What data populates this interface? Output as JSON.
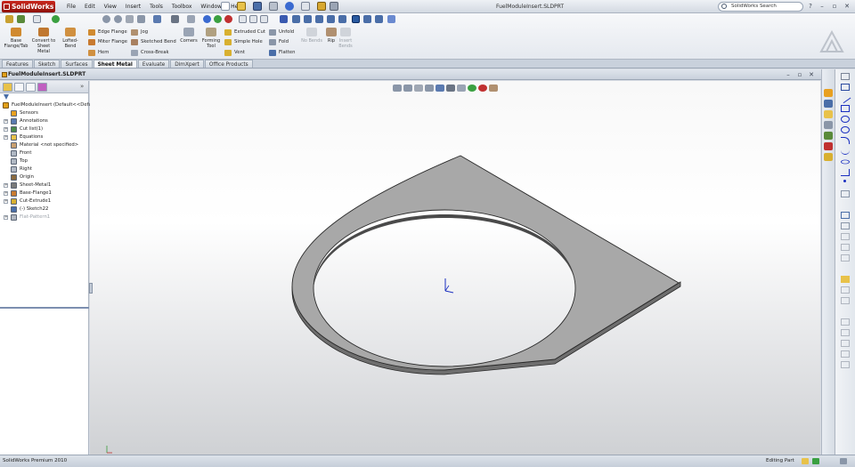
{
  "app": {
    "name": "SolidWorks",
    "file_title": "FuelModuleInsert.SLDPRT",
    "search_placeholder": "SolidWorks Search",
    "help_label": "?",
    "window_controls": [
      "minimize-icon",
      "restore-icon",
      "close-icon"
    ]
  },
  "menu": [
    "File",
    "Edit",
    "View",
    "Insert",
    "Tools",
    "Toolbox",
    "Window",
    "Help"
  ],
  "commands": {
    "large": [
      {
        "label": "Base Flange/Tab",
        "icon": "base-flange-icon"
      },
      {
        "label": "Convert to Sheet Metal",
        "icon": "convert-sheet-metal-icon"
      },
      {
        "label": "Lofted-Bend",
        "icon": "lofted-bend-icon"
      },
      {
        "label": "Corners",
        "icon": "corners-icon"
      },
      {
        "label": "Forming Tool",
        "icon": "forming-tool-icon"
      },
      {
        "label": "No Bends",
        "icon": "no-bends-icon"
      },
      {
        "label": "Rip",
        "icon": "rip-icon"
      },
      {
        "label": "Insert Bends",
        "icon": "insert-bends-icon"
      }
    ],
    "small": [
      {
        "label": "Edge Flange",
        "icon": "edge-flange-icon"
      },
      {
        "label": "Miter Flange",
        "icon": "miter-flange-icon"
      },
      {
        "label": "Hem",
        "icon": "hem-icon"
      },
      {
        "label": "Jog",
        "icon": "jog-icon"
      },
      {
        "label": "Sketched Bend",
        "icon": "sketched-bend-icon"
      },
      {
        "label": "Cross-Break",
        "icon": "cross-break-icon"
      },
      {
        "label": "Extruded Cut",
        "icon": "extruded-cut-icon"
      },
      {
        "label": "Simple Hole",
        "icon": "simple-hole-icon"
      },
      {
        "label": "Vent",
        "icon": "vent-icon"
      },
      {
        "label": "Unfold",
        "icon": "unfold-icon"
      },
      {
        "label": "Fold",
        "icon": "fold-icon"
      },
      {
        "label": "Flatten",
        "icon": "flatten-icon"
      }
    ]
  },
  "tabs": [
    {
      "label": "Features",
      "active": false
    },
    {
      "label": "Sketch",
      "active": false
    },
    {
      "label": "Surfaces",
      "active": false
    },
    {
      "label": "Sheet Metal",
      "active": true
    },
    {
      "label": "Evaluate",
      "active": false
    },
    {
      "label": "DimXpert",
      "active": false
    },
    {
      "label": "Office Products",
      "active": false
    }
  ],
  "document": {
    "title": "FuelModuleInsert.SLDPRT"
  },
  "feature_tree": {
    "root": "FuelModuleInsert (Default<<Defa...",
    "items": [
      {
        "label": "Sensors",
        "icon": "sensors-icon",
        "expandable": false,
        "suppressed": false
      },
      {
        "label": "Annotations",
        "icon": "annotations-icon",
        "expandable": true,
        "suppressed": false
      },
      {
        "label": "Cut list(1)",
        "icon": "cut-list-icon",
        "expandable": true,
        "suppressed": false
      },
      {
        "label": "Equations",
        "icon": "equations-icon",
        "expandable": true,
        "suppressed": false
      },
      {
        "label": "Material <not specified>",
        "icon": "material-icon",
        "expandable": false,
        "suppressed": false
      },
      {
        "label": "Front",
        "icon": "plane-icon",
        "expandable": false,
        "suppressed": false
      },
      {
        "label": "Top",
        "icon": "plane-icon",
        "expandable": false,
        "suppressed": false
      },
      {
        "label": "Right",
        "icon": "plane-icon",
        "expandable": false,
        "suppressed": false
      },
      {
        "label": "Origin",
        "icon": "origin-icon",
        "expandable": false,
        "suppressed": false
      },
      {
        "label": "Sheet-Metal1",
        "icon": "sheet-metal-icon",
        "expandable": true,
        "suppressed": false
      },
      {
        "label": "Base-Flange1",
        "icon": "base-flange-icon",
        "expandable": true,
        "suppressed": false
      },
      {
        "label": "Cut-Extrude1",
        "icon": "cut-extrude-icon",
        "expandable": true,
        "suppressed": false
      },
      {
        "label": "(-) Sketch22",
        "icon": "sketch-icon",
        "expandable": false,
        "suppressed": false
      },
      {
        "label": "Flat-Pattern1",
        "icon": "flat-pattern-icon",
        "expandable": true,
        "suppressed": true
      }
    ]
  },
  "status": {
    "product": "SolidWorks Premium 2010",
    "mode": "Editing Part"
  },
  "colors": {
    "accent": "#c8261c",
    "part_face": "#a8a8a8",
    "part_edge": "#3a3a3a",
    "origin": "#1a2fc0"
  }
}
